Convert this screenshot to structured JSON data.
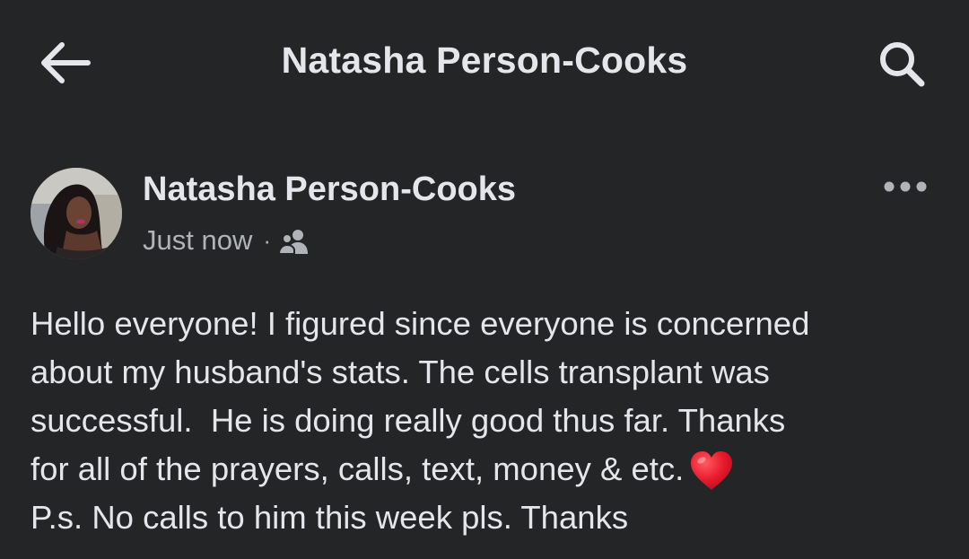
{
  "header": {
    "title": "Natasha Person-Cooks",
    "back_icon": "back-arrow-icon",
    "search_icon": "search-icon"
  },
  "post": {
    "author": "Natasha Person-Cooks",
    "timestamp": "Just now",
    "separator": "·",
    "audience_icon": "friends-audience-icon",
    "more_icon": "more-options-icon",
    "lines": [
      "Hello everyone! I figured since everyone is concerned",
      "about my husband's stats. The cells transplant was",
      "successful.  He is doing really good thus far. Thanks",
      "for all of the prayers, calls, text, money & etc.",
      "P.s. No calls to him this week pls. Thanks"
    ],
    "emoji": "red-heart-icon"
  },
  "colors": {
    "background": "#242526",
    "primary_text": "#e4e6eb",
    "secondary_text": "#b0b3b8",
    "heart": "#e8192c"
  }
}
